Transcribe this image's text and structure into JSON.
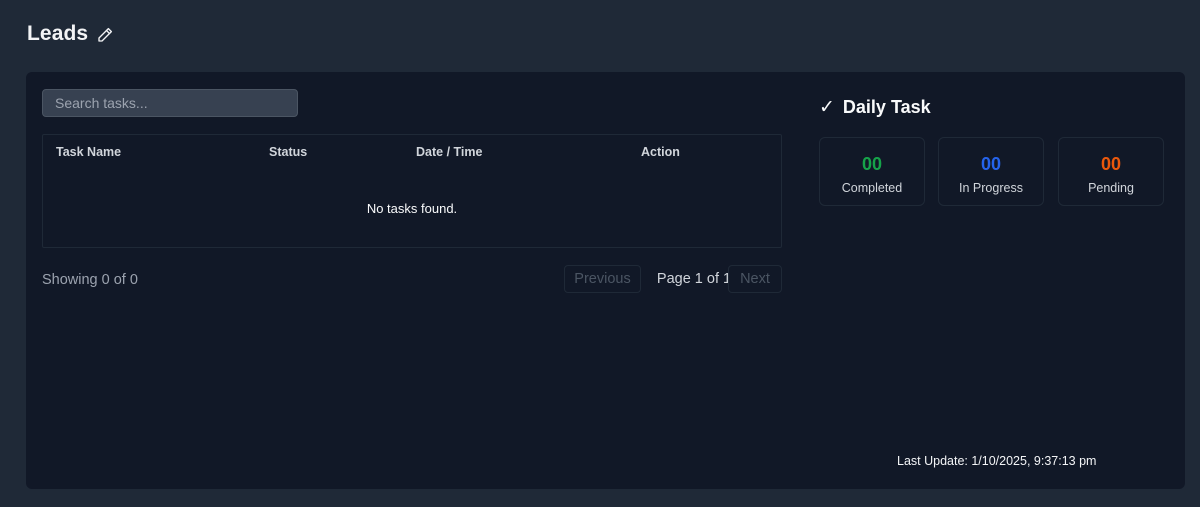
{
  "header": {
    "title": "Leads",
    "edit_icon": "pencil-icon"
  },
  "tasks": {
    "search_placeholder": "Search tasks...",
    "columns": [
      "Task Name",
      "Status",
      "Date / Time",
      "Action"
    ],
    "empty_message": "No tasks found.",
    "showing": "Showing 0 of 0",
    "pagination": {
      "previous": "Previous",
      "page_info": "Page 1 of 1",
      "next": "Next"
    }
  },
  "daily_task": {
    "icon": "check-icon",
    "icon_glyph": "✓",
    "title": "Daily Task",
    "stats": [
      {
        "value": "00",
        "label": "Completed",
        "color": "#16a34a"
      },
      {
        "value": "00",
        "label": "In Progress",
        "color": "#2563eb"
      },
      {
        "value": "00",
        "label": "Pending",
        "color": "#ea580c"
      }
    ]
  },
  "last_update": "Last Update: 1/10/2025, 9:37:13 pm"
}
